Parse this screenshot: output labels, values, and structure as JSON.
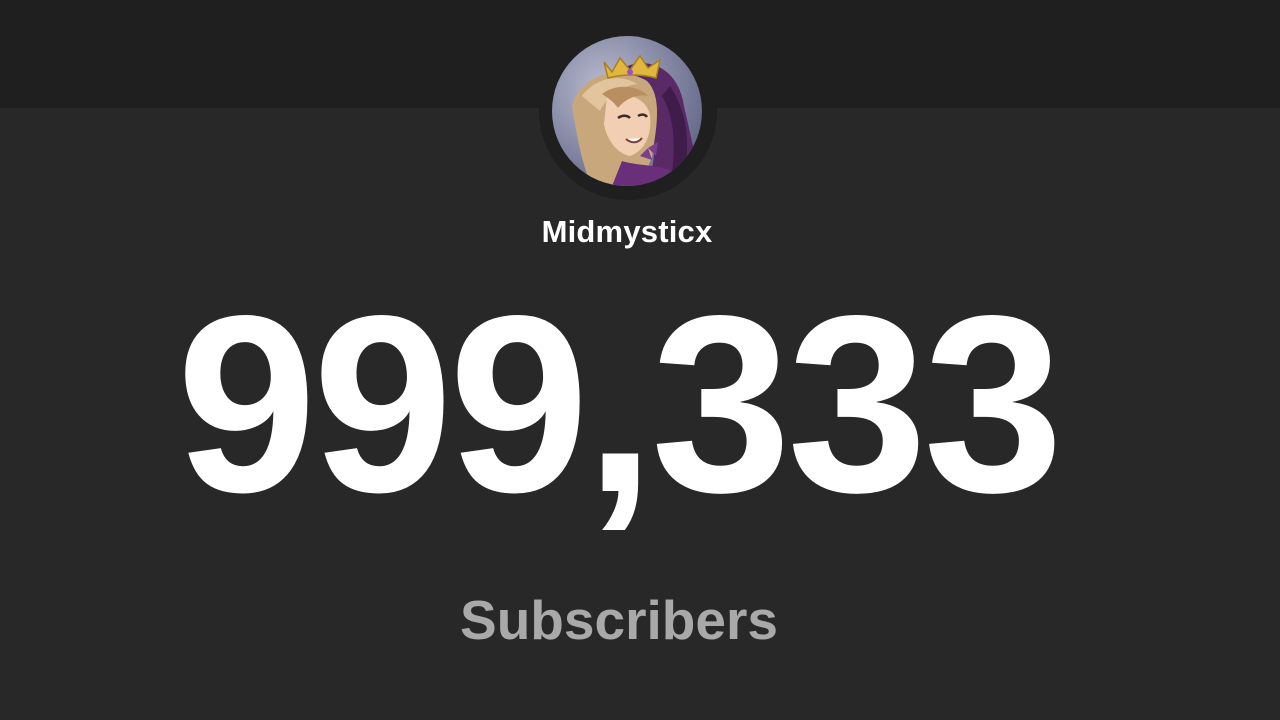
{
  "channel": {
    "name": "Midmysticx",
    "avatar_icon": "channel-avatar-icon"
  },
  "stats": {
    "subscriber_count": "999,333",
    "subscriber_label": "Subscribers"
  },
  "colors": {
    "background": "#282828",
    "header": "#1f1f1f",
    "count_text": "#ffffff",
    "label_text": "#a9a9a9"
  }
}
